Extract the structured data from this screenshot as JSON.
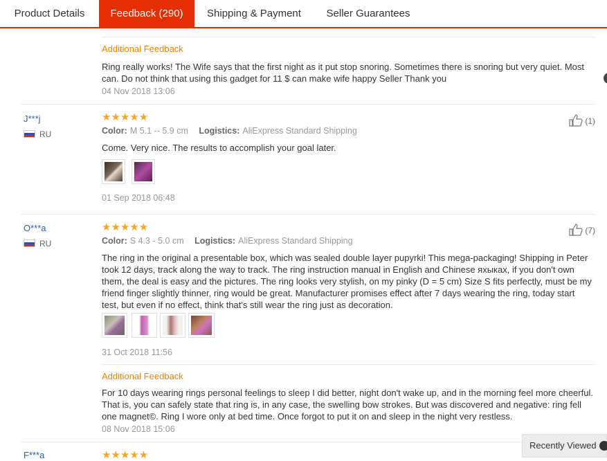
{
  "tabs": [
    {
      "label": "Product Details"
    },
    {
      "label": "Feedback (290)"
    },
    {
      "label": "Shipping & Payment"
    },
    {
      "label": "Seller Guarantees"
    }
  ],
  "first": {
    "additional_label": "Additional Feedback",
    "additional_text": "Ring really works! The Wife says that the first night as it put stop snoring. Sometimes there is snoring but very quiet. Most can. Do not think that using this gadget for 11 $ can make wife happy Seller Thank you",
    "additional_date": "04 Nov 2018 13:06"
  },
  "reviews": [
    {
      "user": "J***j",
      "country": "RU",
      "stars": "★★★★★",
      "color_label": "Color:",
      "color_value": "M 5.1 -- 5.9 cm",
      "logistics_label": "Logistics:",
      "logistics_value": "AliExpress Standard Shipping",
      "helpful": "(1)",
      "text": "Come. Very nice. The results to accomplish your goal later.",
      "date": "01 Sep 2018 06:48"
    },
    {
      "user": "O***a",
      "country": "RU",
      "stars": "★★★★★",
      "color_label": "Color:",
      "color_value": "S 4.3 - 5.0 cm",
      "logistics_label": "Logistics:",
      "logistics_value": "AliExpress Standard Shipping",
      "helpful": "(7)",
      "text": "The ring in the original a presentable box, which was sealed double layer pupyrki! This mega-packaging! Shipping in Peter took 12 days, track along the way to track. The ring instruction manual in English and Chinese яхыках, if you don't own them, the deal is easy and the pictures. The ring looks very stylish, on my pinky (D = 5 cm) Size S fits perfectly, must be my friend finger slightly thinner, ring would be great. Manufacturer promises effect after 7 days wearing the ring, today start test, but even if no effect, think that's still wear the ring just as decoration.",
      "date": "31 Oct 2018 11:56",
      "additional_label": "Additional Feedback",
      "additional_text": "For 10 days wearing rings personal feelings to sleep I did better, night don't wake up, and in the morning feel more cheerful. That is, you can safely state that ring is, in any case, the swelling bow strokes. But was discovered and negative: ring fell one magnet©. Ring I wore only at bed time. Once forgot to put it on and sleep in the night very restless.",
      "additional_date": "08 Nov 2018 15:06"
    },
    {
      "user": "F***a",
      "stars": "★★★★★"
    }
  ],
  "recently_viewed": "Recently Viewed"
}
